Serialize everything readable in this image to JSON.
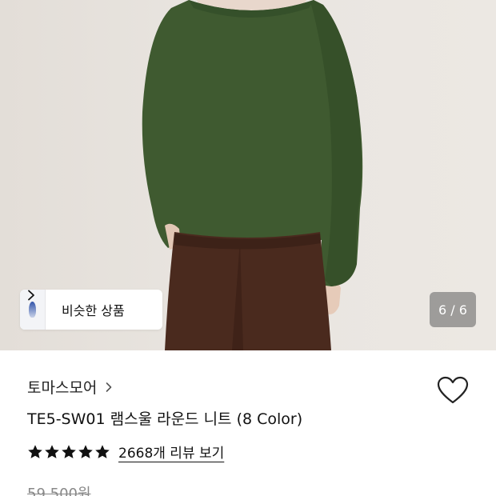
{
  "gallery": {
    "similar_label": "비슷한 상품",
    "counter": "6 / 6"
  },
  "product": {
    "brand": "토마스모어",
    "name": "TE5-SW01 램스울 라운드 니트 (8 Color)",
    "rating_stars": 5,
    "review_link": "2668개 리뷰 보기",
    "original_price": "59,500원"
  },
  "colors": {
    "sweater": "#3f5a30",
    "pants": "#4a2a1e",
    "background": "#e9e5e0",
    "star": "#111111"
  },
  "icons": {
    "chevron": "chevron-right-icon",
    "heart": "heart-outline-icon",
    "star": "star-filled-icon"
  }
}
